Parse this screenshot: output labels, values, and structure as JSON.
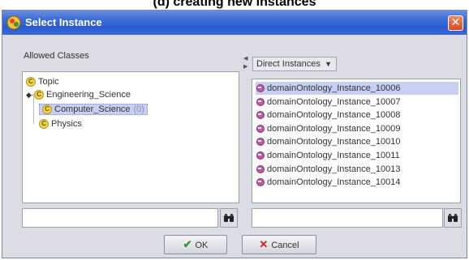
{
  "caption": "(d) creating new instances",
  "window": {
    "title": "Select Instance",
    "close_glyph": "✕"
  },
  "left_panel": {
    "label": "Allowed Classes",
    "tree": [
      {
        "label": "Topic",
        "depth": 0,
        "expander": "",
        "selected": false,
        "count": ""
      },
      {
        "label": "Engineering_Science",
        "depth": 1,
        "expander": "◆-",
        "selected": false,
        "count": ""
      },
      {
        "label": "Computer_Science",
        "depth": 2,
        "expander": "",
        "selected": true,
        "count": "(0)"
      },
      {
        "label": "Physics",
        "depth": 2,
        "expander": "",
        "selected": false,
        "count": ""
      }
    ],
    "search_value": ""
  },
  "right_panel": {
    "dropdown_label": "Direct Instances",
    "instances": [
      {
        "label": "domainOntology_Instance_10006",
        "selected": true
      },
      {
        "label": "domainOntology_Instance_10007",
        "selected": false
      },
      {
        "label": "domainOntology_Instance_10008",
        "selected": false
      },
      {
        "label": "domainOntology_Instance_10009",
        "selected": false
      },
      {
        "label": "domainOntology_Instance_10010",
        "selected": false
      },
      {
        "label": "domainOntology_Instance_10011",
        "selected": false
      },
      {
        "label": "domainOntology_Instance_10013",
        "selected": false
      },
      {
        "label": "domainOntology_Instance_10014",
        "selected": false
      }
    ],
    "search_value": ""
  },
  "buttons": {
    "ok_label": "OK",
    "cancel_label": "Cancel"
  },
  "colors": {
    "titlebar": "#2a5cd0",
    "selection": "#c7cff3",
    "class_icon": "#f5d44a",
    "instance_icon": "#c25aa0"
  },
  "icons": {
    "class": "class-icon",
    "instance": "instance-icon",
    "search": "binoculars-icon",
    "ok": "checkmark-icon",
    "cancel": "x-icon"
  }
}
